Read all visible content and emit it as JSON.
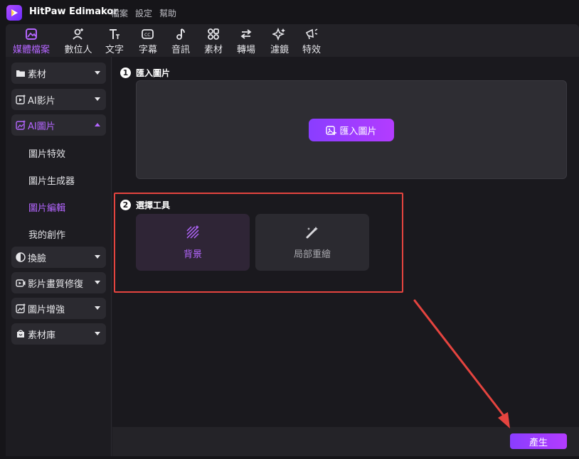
{
  "app": {
    "title": "HitPaw Edimakor"
  },
  "menu": [
    "檔案",
    "設定",
    "幫助"
  ],
  "toolbar": [
    {
      "label": "媒體檔案",
      "icon": "media-icon",
      "active": true
    },
    {
      "label": "數位人",
      "icon": "avatar-icon"
    },
    {
      "label": "文字",
      "icon": "text-icon"
    },
    {
      "label": "字幕",
      "icon": "subtitle-icon"
    },
    {
      "label": "音訊",
      "icon": "music-icon"
    },
    {
      "label": "素材",
      "icon": "assets-icon"
    },
    {
      "label": "轉場",
      "icon": "transition-icon"
    },
    {
      "label": "濾鏡",
      "icon": "filter-icon"
    },
    {
      "label": "特效",
      "icon": "effects-icon"
    }
  ],
  "sidebar": {
    "items": [
      {
        "label": "素材",
        "icon": "folder-icon"
      },
      {
        "label": "AI影片",
        "icon": "ai-video-icon"
      },
      {
        "label": "AI圖片",
        "icon": "ai-image-icon",
        "active": true
      },
      {
        "label": "換臉",
        "icon": "face-swap-icon"
      },
      {
        "label": "影片畫質修復",
        "icon": "video-repair-icon"
      },
      {
        "label": "圖片增強",
        "icon": "image-enhance-icon"
      },
      {
        "label": "素材庫",
        "icon": "library-icon"
      }
    ],
    "subitems": [
      {
        "label": "圖片特效"
      },
      {
        "label": "圖片生成器"
      },
      {
        "label": "圖片編輯",
        "active": true
      },
      {
        "label": "我的創作"
      }
    ]
  },
  "content": {
    "step1": {
      "number": "1",
      "title": "匯入圖片"
    },
    "import_button": "匯入圖片",
    "step2": {
      "number": "2",
      "title": "選擇工具"
    },
    "tools": [
      {
        "label": "背景",
        "icon": "background-icon",
        "active": true
      },
      {
        "label": "局部重繪",
        "icon": "magic-wand-icon"
      }
    ]
  },
  "footer": {
    "generate_button": "產生"
  },
  "colors": {
    "accent": "#b466ff",
    "highlight": "#e5443f",
    "arrow": "#e5443f"
  }
}
